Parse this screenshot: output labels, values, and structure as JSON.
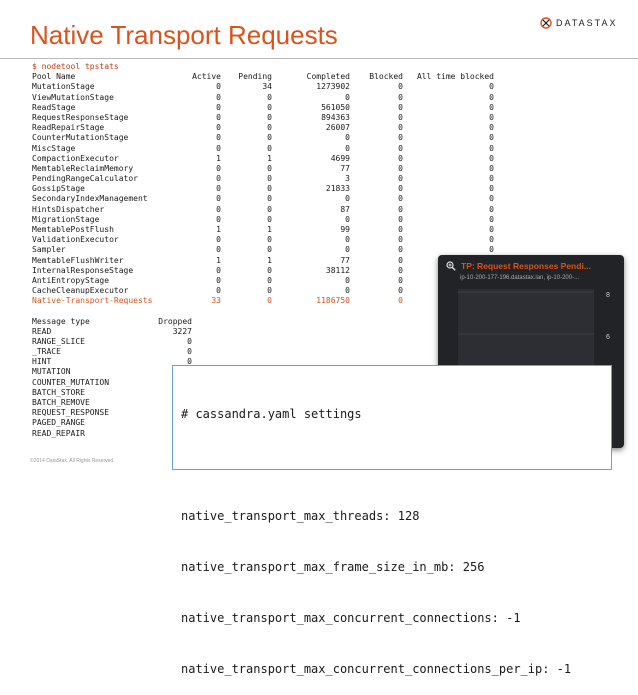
{
  "slide": {
    "title": "Native Transport Requests",
    "logo": "DATASTAX",
    "footer": "©2014 DataStax. All Rights Reserved."
  },
  "terminal": {
    "command": "$ nodetool tpstats",
    "headers": [
      "Pool Name",
      "Active",
      "Pending",
      "Completed",
      "Blocked",
      "All time blocked"
    ],
    "rows": [
      [
        "MutationStage",
        "0",
        "34",
        "1273902",
        "0",
        "0"
      ],
      [
        "ViewMutationStage",
        "0",
        "0",
        "0",
        "0",
        "0"
      ],
      [
        "ReadStage",
        "0",
        "0",
        "561050",
        "0",
        "0"
      ],
      [
        "RequestResponseStage",
        "0",
        "0",
        "894363",
        "0",
        "0"
      ],
      [
        "ReadRepairStage",
        "0",
        "0",
        "26007",
        "0",
        "0"
      ],
      [
        "CounterMutationStage",
        "0",
        "0",
        "0",
        "0",
        "0"
      ],
      [
        "MiscStage",
        "0",
        "0",
        "0",
        "0",
        "0"
      ],
      [
        "CompactionExecutor",
        "1",
        "1",
        "4699",
        "0",
        "0"
      ],
      [
        "MemtableReclaimMemory",
        "0",
        "0",
        "77",
        "0",
        "0"
      ],
      [
        "PendingRangeCalculator",
        "0",
        "0",
        "3",
        "0",
        "0"
      ],
      [
        "GossipStage",
        "0",
        "0",
        "21833",
        "0",
        "0"
      ],
      [
        "SecondaryIndexManagement",
        "0",
        "0",
        "0",
        "0",
        "0"
      ],
      [
        "HintsDispatcher",
        "0",
        "0",
        "87",
        "0",
        "0"
      ],
      [
        "MigrationStage",
        "0",
        "0",
        "0",
        "0",
        "0"
      ],
      [
        "MemtablePostFlush",
        "1",
        "1",
        "99",
        "0",
        "0"
      ],
      [
        "ValidationExecutor",
        "0",
        "0",
        "0",
        "0",
        "0"
      ],
      [
        "Sampler",
        "0",
        "0",
        "0",
        "0",
        "0"
      ],
      [
        "MemtableFlushWriter",
        "1",
        "1",
        "77",
        "0",
        "0"
      ],
      [
        "InternalResponseStage",
        "0",
        "0",
        "38112",
        "0",
        "0"
      ],
      [
        "AntiEntropyStage",
        "0",
        "0",
        "0",
        "0",
        "0"
      ],
      [
        "CacheCleanupExecutor",
        "0",
        "0",
        "0",
        "0",
        "0"
      ],
      [
        "Native-Transport-Requests",
        "33",
        "0",
        "1186750",
        "0",
        ""
      ]
    ],
    "dropped_headers": [
      "Message type",
      "Dropped"
    ],
    "dropped_rows": [
      [
        "READ",
        "3227"
      ],
      [
        "RANGE_SLICE",
        "0"
      ],
      [
        "_TRACE",
        "0"
      ],
      [
        "HINT",
        "0"
      ],
      [
        "MUTATION",
        ""
      ],
      [
        "COUNTER_MUTATION",
        ""
      ],
      [
        "BATCH_STORE",
        ""
      ],
      [
        "BATCH_REMOVE",
        ""
      ],
      [
        "REQUEST_RESPONSE",
        ""
      ],
      [
        "PAGED_RANGE",
        ""
      ],
      [
        "READ_REPAIR",
        ""
      ]
    ]
  },
  "popup": {
    "title": "TP: Request Responses Pendi...",
    "subtitle": "ip-10-200-177-196.datastax.lan, ip-10-200-...",
    "y_ticks": [
      "8",
      "6",
      "4"
    ],
    "accent": "#d9541b"
  },
  "code": {
    "lines": [
      "# cassandra.yaml settings",
      "",
      "native_transport_max_threads: 128",
      "native_transport_max_frame_size_in_mb: 256",
      "native_transport_max_concurrent_connections: -1",
      "native_transport_max_concurrent_connections_per_ip: -1"
    ]
  }
}
